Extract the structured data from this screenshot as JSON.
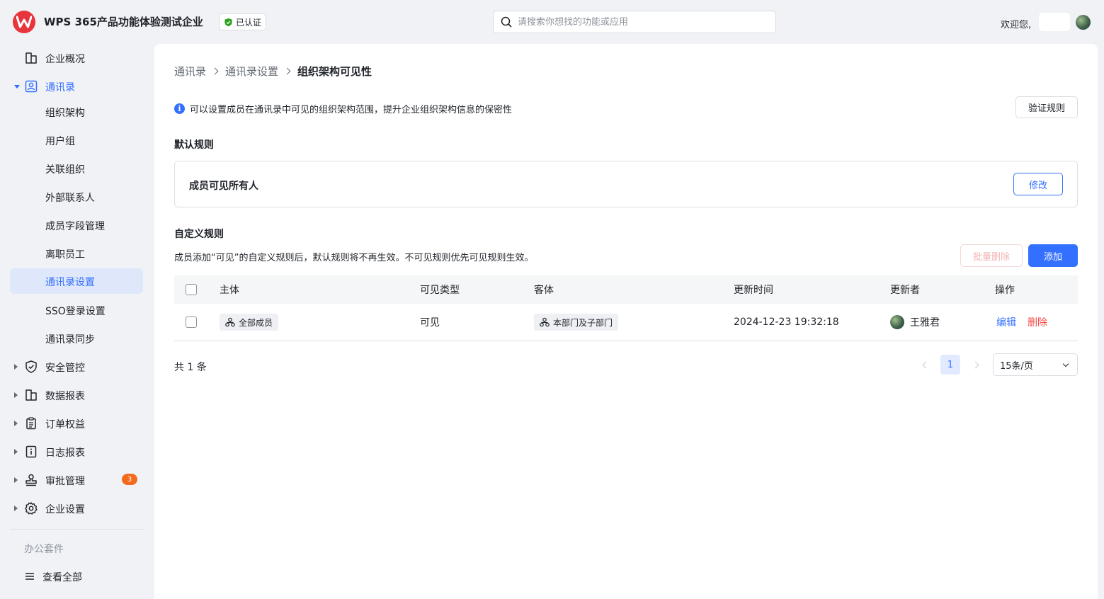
{
  "header": {
    "org_name": "WPS 365产品功能体验测试企业",
    "verified_label": "已认证",
    "search_placeholder": "请搜索你想找的功能或应用",
    "welcome": "欢迎您,"
  },
  "sidebar": {
    "items": [
      {
        "label": "企业概况",
        "icon": "building-icon"
      },
      {
        "label": "通讯录",
        "icon": "contacts-icon"
      },
      {
        "label": "组织架构"
      },
      {
        "label": "用户组"
      },
      {
        "label": "关联组织"
      },
      {
        "label": "外部联系人"
      },
      {
        "label": "成员字段管理"
      },
      {
        "label": "离职员工"
      },
      {
        "label": "通讯录设置"
      },
      {
        "label": "SSO登录设置"
      },
      {
        "label": "通讯录同步"
      },
      {
        "label": "安全管控",
        "icon": "shield-check-icon"
      },
      {
        "label": "数据报表",
        "icon": "report-icon"
      },
      {
        "label": "订单权益",
        "icon": "clipboard-icon"
      },
      {
        "label": "日志报表",
        "icon": "log-icon"
      },
      {
        "label": "审批管理",
        "icon": "stamp-icon",
        "badge": "3"
      },
      {
        "label": "企业设置",
        "icon": "gear-icon"
      }
    ],
    "section_label": "办公套件",
    "view_all": "查看全部"
  },
  "breadcrumb": [
    "通讯录",
    "通讯录设置",
    "组织架构可见性"
  ],
  "notice": "可以设置成员在通讯录中可见的组织架构范围，提升企业组织架构信息的保密性",
  "buttons": {
    "verify_rules": "验证规则",
    "modify": "修改",
    "batch_delete": "批量删除",
    "add": "添加"
  },
  "default_rule": {
    "title": "默认规则",
    "text": "成员可见所有人"
  },
  "custom_rule": {
    "title": "自定义规则",
    "description": "成员添加“可见”的自定义规则后，默认规则将不再生效。不可见规则优先可见规则生效。"
  },
  "table": {
    "columns": [
      "主体",
      "可见类型",
      "客体",
      "更新时间",
      "更新者",
      "操作"
    ],
    "rows": [
      {
        "subject": "全部成员",
        "visibility": "可见",
        "object": "本部门及子部门",
        "updated_at": "2024-12-23 19:32:18",
        "updater": "王雅君",
        "edit": "编辑",
        "delete": "删除"
      }
    ]
  },
  "pagination": {
    "total": "共 1 条",
    "current_page": "1",
    "page_size": "15条/页"
  },
  "colors": {
    "primary": "#3370ff",
    "danger": "#f54a45",
    "brand_red": "#e8343d",
    "badge_orange": "#f26b1d"
  }
}
